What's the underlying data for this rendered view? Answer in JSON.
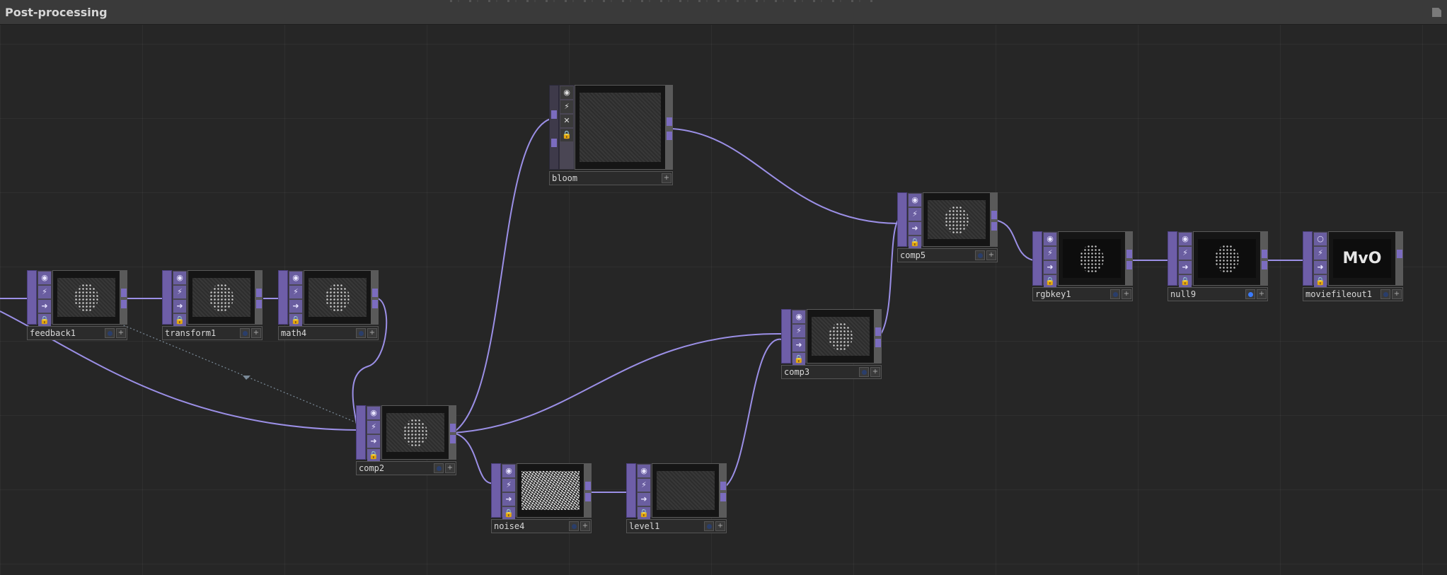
{
  "window": {
    "title": "Post-processing"
  },
  "colors": {
    "wire": "#9b8fe6",
    "node_strip": "#6e5ea8",
    "viewer_active": "#3a7bff"
  },
  "nodes": {
    "feedback1": {
      "label": "feedback1"
    },
    "transform1": {
      "label": "transform1"
    },
    "math4": {
      "label": "math4"
    },
    "comp2": {
      "label": "comp2"
    },
    "bloom": {
      "label": "bloom"
    },
    "noise4": {
      "label": "noise4"
    },
    "level1": {
      "label": "level1"
    },
    "comp3": {
      "label": "comp3"
    },
    "comp5": {
      "label": "comp5"
    },
    "rgbkey1": {
      "label": "rgbkey1"
    },
    "null9": {
      "label": "null9"
    },
    "moviefileout1": {
      "label": "moviefileout1",
      "preview_text": "MvO"
    }
  },
  "icons": {
    "node_controls": [
      "viewer-toggle-icon",
      "bypass-icon",
      "display-icon",
      "lock-icon"
    ],
    "label_bar": [
      "viewer-dot-icon",
      "plus-icon"
    ]
  },
  "plus_glyph": "+"
}
